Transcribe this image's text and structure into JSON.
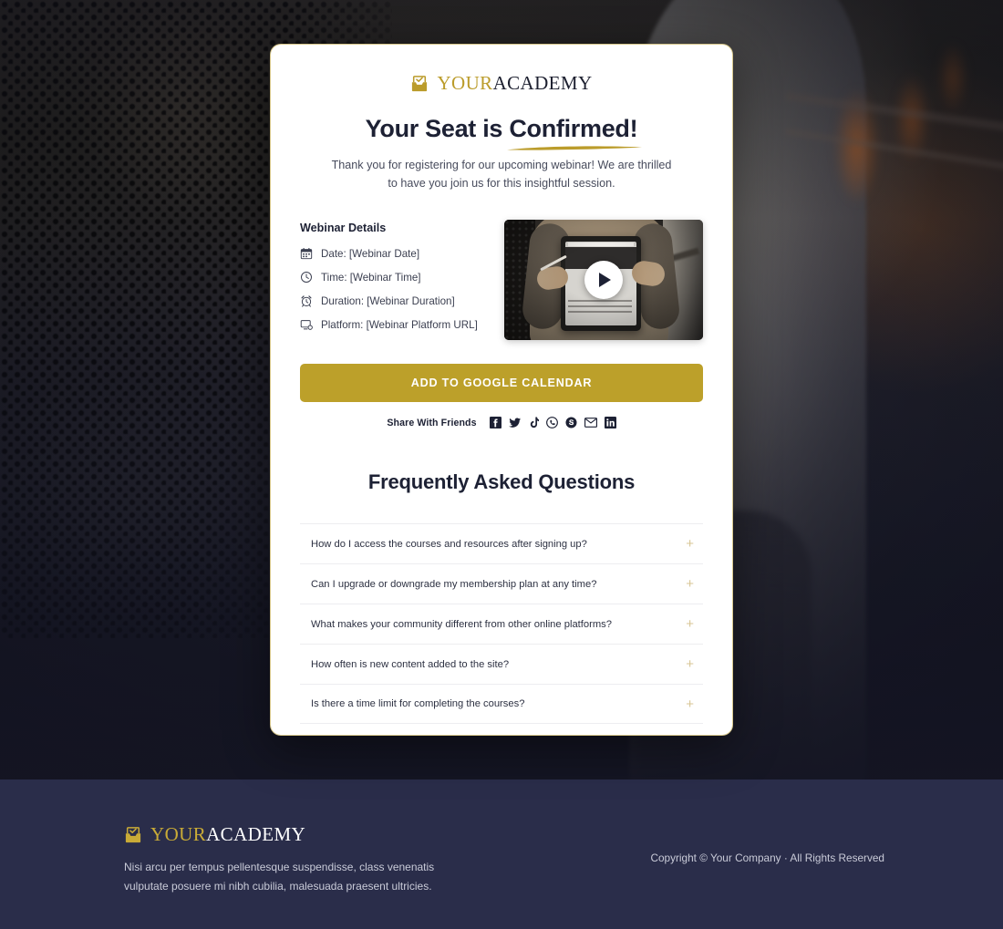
{
  "brand": {
    "icon": "inbox-check-icon",
    "name_first": "YOUR",
    "name_second": "ACADEMY",
    "gold": "#bb9c2b"
  },
  "hero": {
    "headline_part1": "Your Seat is ",
    "headline_part2": "Confirmed!",
    "subcopy": "Thank you for registering for our upcoming webinar! We are thrilled to have you join us for this insightful session."
  },
  "details": {
    "title": "Webinar Details",
    "rows": [
      {
        "icon": "calendar-icon",
        "label": "Date: [Webinar Date]"
      },
      {
        "icon": "clock-icon",
        "label": "Time: [Webinar Time]"
      },
      {
        "icon": "alarm-clock-icon",
        "label": "Duration: [Webinar Duration]"
      },
      {
        "icon": "monitor-icon",
        "label": "Platform: [Webinar Platform URL]"
      }
    ]
  },
  "video": {
    "play_icon": "play-icon",
    "alt": "Person holding a tablet with a stylus"
  },
  "cta": {
    "label": "ADD TO GOOGLE CALENDAR",
    "color": "#bca02a"
  },
  "share": {
    "label": "Share With Friends",
    "icons": [
      "facebook-icon",
      "twitter-icon",
      "tiktok-icon",
      "whatsapp-icon",
      "skype-icon",
      "email-icon",
      "linkedin-icon"
    ]
  },
  "faq": {
    "title": "Frequently Asked Questions",
    "expand_glyph": "+",
    "items": [
      "How do I access the courses and resources after signing up?",
      "Can I upgrade or downgrade my membership plan at any time?",
      "What makes your community different from other online platforms?",
      "How often is new content added to the site?",
      "Is there a time limit for completing the courses?"
    ]
  },
  "footer": {
    "brand_first": "YOUR",
    "brand_second": "ACADEMY",
    "description": "Nisi arcu per tempus pellentesque suspendisse, class venenatis vulputate posuere mi nibh cubilia, malesuada praesent ultricies.",
    "copyright": "Copyright © Your Company · All Rights Reserved",
    "background": "#2a2d4a"
  }
}
